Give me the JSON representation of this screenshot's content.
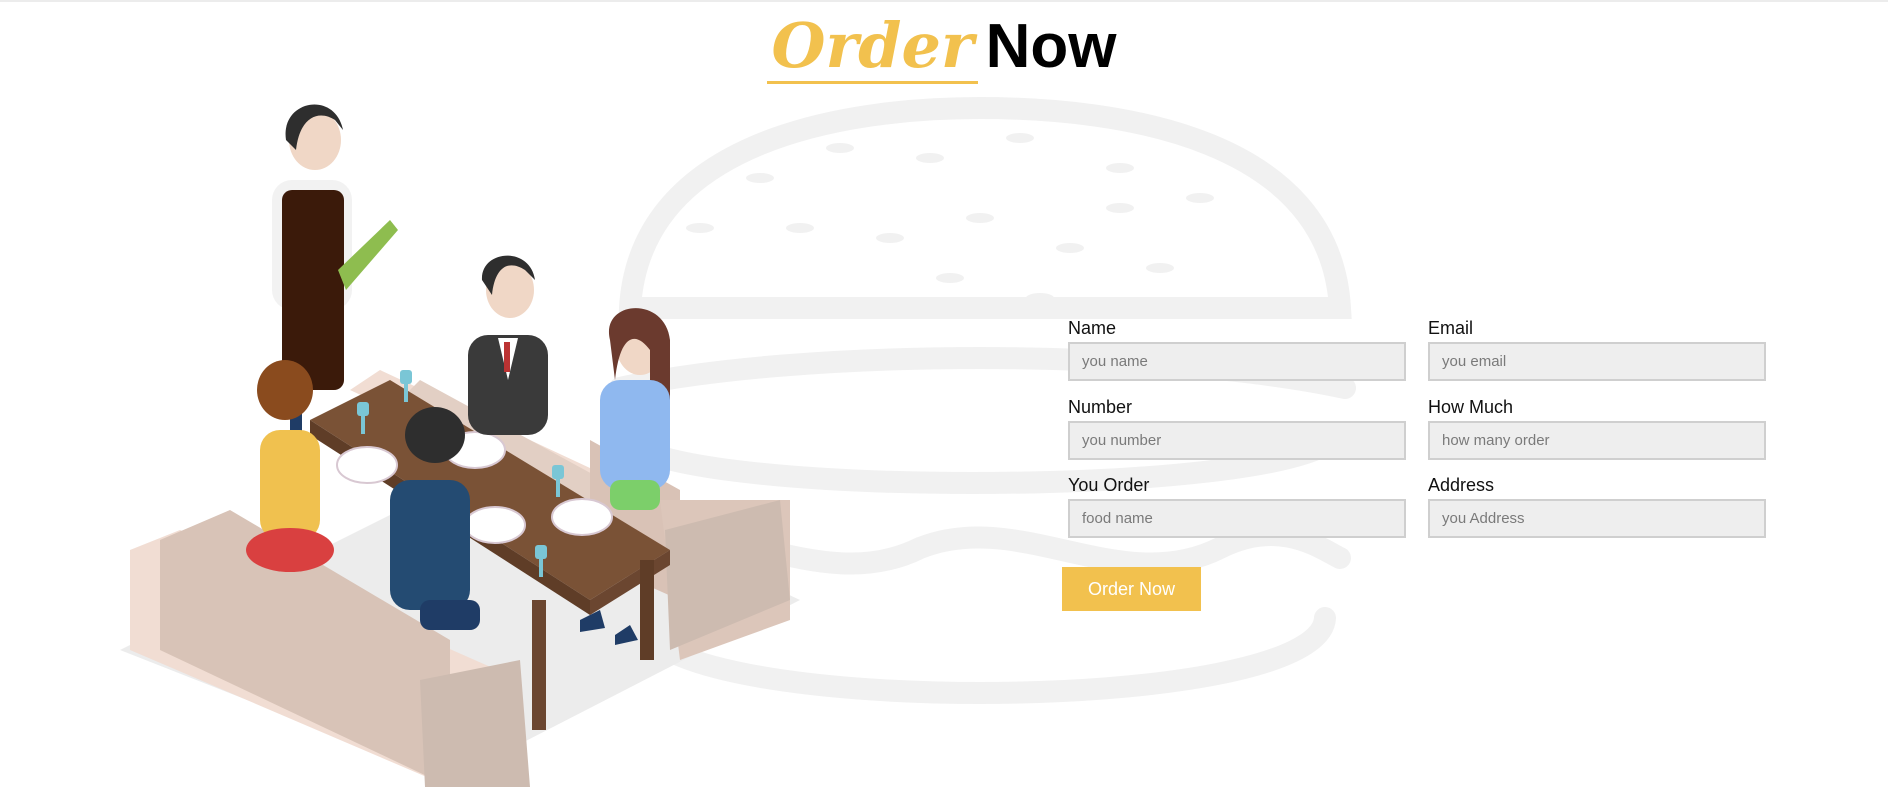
{
  "header": {
    "title_accent": "Order",
    "title_main": "Now"
  },
  "form": {
    "fields": [
      {
        "label": "Name",
        "placeholder": "you name"
      },
      {
        "label": "Email",
        "placeholder": "you email"
      },
      {
        "label": "Number",
        "placeholder": "you number"
      },
      {
        "label": "How Much",
        "placeholder": "how many order"
      },
      {
        "label": "You Order",
        "placeholder": "food name"
      },
      {
        "label": "Address",
        "placeholder": "you Address"
      }
    ],
    "submit_label": "Order Now"
  },
  "theme": {
    "accent": "#f2c14e",
    "input_bg": "#eeeeee",
    "watermark": "#f1f1f1"
  },
  "illustration": {
    "icon": "restaurant-table-illustration",
    "background_icon": "burger-watermark-icon"
  }
}
